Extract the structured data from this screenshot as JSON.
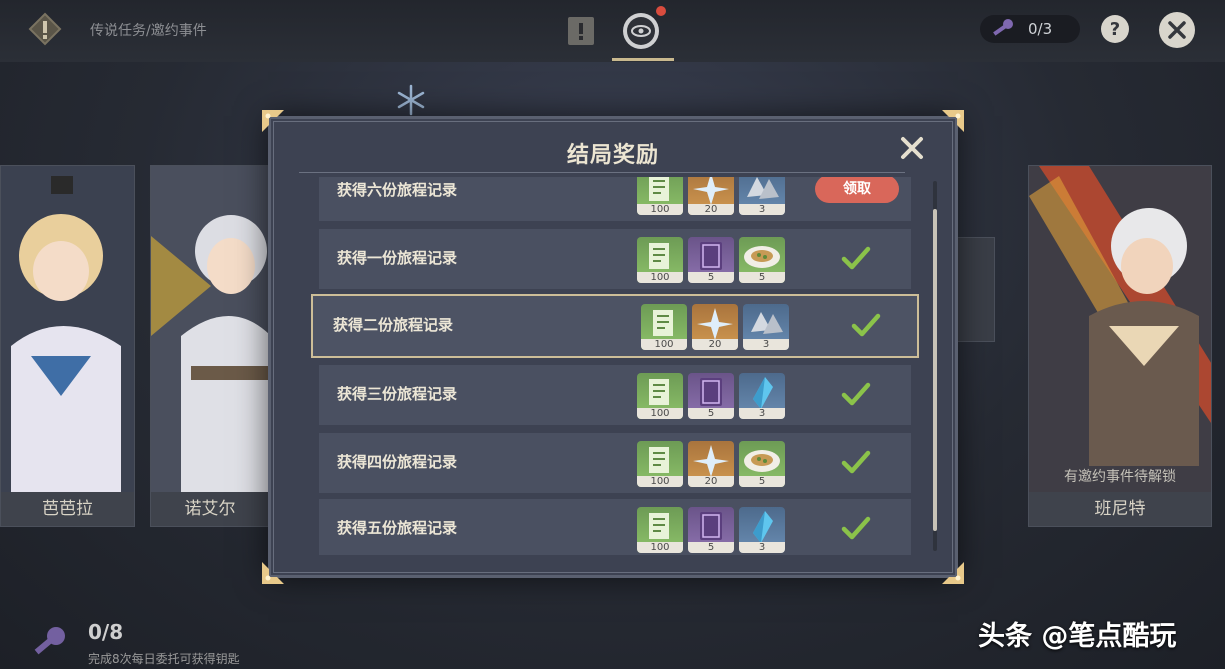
{
  "topbar": {
    "breadcrumb": "传说任务/邀约事件",
    "key_count": "0/3",
    "help_label": "?"
  },
  "cards": {
    "barbara": "芭芭拉",
    "noelle": "诺艾尔",
    "bennett": "班尼特",
    "bennett_hint": "有邀约事件待解锁"
  },
  "bottom": {
    "count": "0/8",
    "hint": "完成8次每日委托可获得钥匙"
  },
  "watermark": "头条 @笔点酷玩",
  "modal": {
    "title": "结局奖励",
    "claim_label": "领取",
    "rows": [
      {
        "label": "获得六份旅程记录",
        "status": "claimable",
        "items": [
          {
            "icon": "adventure-exp-icon",
            "qty": "100"
          },
          {
            "icon": "primogem-icon",
            "qty": "20"
          },
          {
            "icon": "mystic-ore-icon",
            "qty": "3"
          }
        ]
      },
      {
        "label": "获得一份旅程记录",
        "status": "claimed",
        "items": [
          {
            "icon": "adventure-exp-icon",
            "qty": "100"
          },
          {
            "icon": "heros-wit-icon",
            "qty": "5"
          },
          {
            "icon": "food-dish-icon",
            "qty": "5"
          }
        ]
      },
      {
        "label": "获得二份旅程记录",
        "status": "claimed",
        "items": [
          {
            "icon": "adventure-exp-icon",
            "qty": "100"
          },
          {
            "icon": "primogem-icon",
            "qty": "20"
          },
          {
            "icon": "mystic-ore-icon",
            "qty": "3"
          }
        ]
      },
      {
        "label": "获得三份旅程记录",
        "status": "claimed",
        "items": [
          {
            "icon": "adventure-exp-icon",
            "qty": "100"
          },
          {
            "icon": "heros-wit-icon",
            "qty": "5"
          },
          {
            "icon": "crystal-shard-icon",
            "qty": "3"
          }
        ]
      },
      {
        "label": "获得四份旅程记录",
        "status": "claimed",
        "items": [
          {
            "icon": "adventure-exp-icon",
            "qty": "100"
          },
          {
            "icon": "primogem-icon",
            "qty": "20"
          },
          {
            "icon": "food-dish-icon",
            "qty": "5"
          }
        ]
      },
      {
        "label": "获得五份旅程记录",
        "status": "claimed",
        "items": [
          {
            "icon": "adventure-exp-icon",
            "qty": "100"
          },
          {
            "icon": "heros-wit-icon",
            "qty": "5"
          },
          {
            "icon": "crystal-shard-icon",
            "qty": "3"
          }
        ]
      }
    ]
  },
  "colors": {
    "accent_gold": "#cdbe98",
    "claim_red": "#d9675a",
    "check_green": "#8bc34a"
  }
}
